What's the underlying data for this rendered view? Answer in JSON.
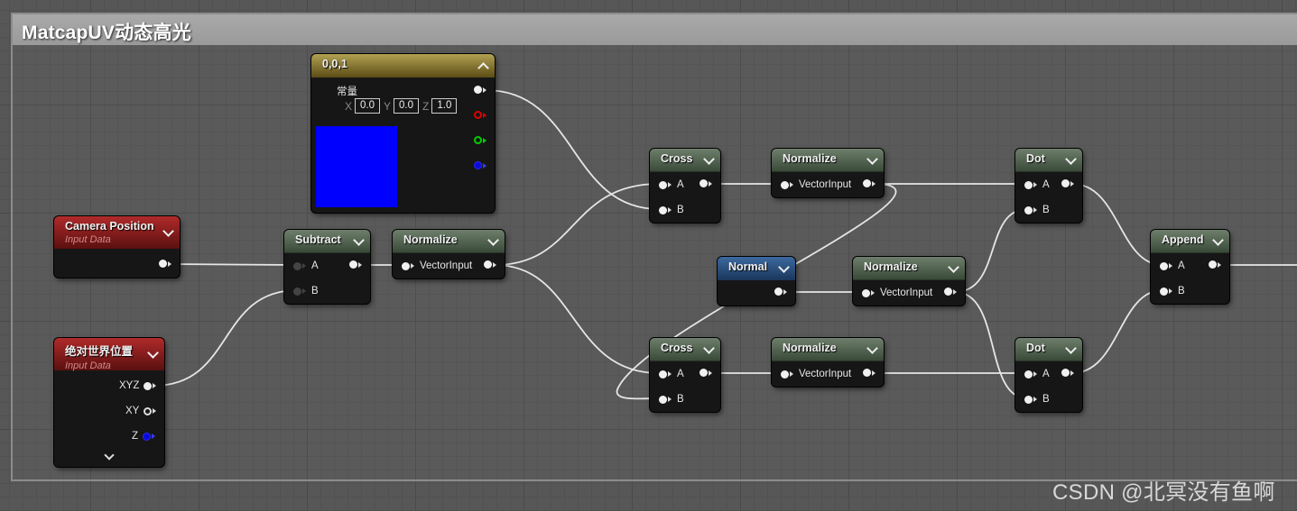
{
  "comment": {
    "title": "MatcapUV动态高光"
  },
  "nodes": {
    "constant": {
      "title": "0,0,1",
      "sublabel": "常量",
      "x_label": "X",
      "x_value": "0.0",
      "y_label": "Y",
      "y_value": "0.0",
      "z_label": "Z",
      "z_value": "1.0",
      "swatch_color": "#0000ff"
    },
    "camera_position": {
      "title": "Camera Position",
      "subtitle": "Input Data"
    },
    "absolute_world_position": {
      "title": "绝对世界位置",
      "subtitle": "Input Data",
      "out_xyz": "XYZ",
      "out_xy": "XY",
      "out_z": "Z"
    },
    "subtract": {
      "title": "Subtract",
      "in_a": "A",
      "in_b": "B"
    },
    "normalize_1": {
      "title": "Normalize",
      "in": "VectorInput"
    },
    "cross_1": {
      "title": "Cross",
      "in_a": "A",
      "in_b": "B"
    },
    "normalize_2": {
      "title": "Normalize",
      "in": "VectorInput"
    },
    "normal": {
      "title": "Normal"
    },
    "normalize_3": {
      "title": "Normalize",
      "in": "VectorInput"
    },
    "cross_2": {
      "title": "Cross",
      "in_a": "A",
      "in_b": "B"
    },
    "normalize_4": {
      "title": "Normalize",
      "in": "VectorInput"
    },
    "dot_1": {
      "title": "Dot",
      "in_a": "A",
      "in_b": "B"
    },
    "dot_2": {
      "title": "Dot",
      "in_a": "A",
      "in_b": "B"
    },
    "append": {
      "title": "Append",
      "in_a": "A",
      "in_b": "B"
    }
  },
  "watermark": "CSDN @北冥没有鱼啊"
}
